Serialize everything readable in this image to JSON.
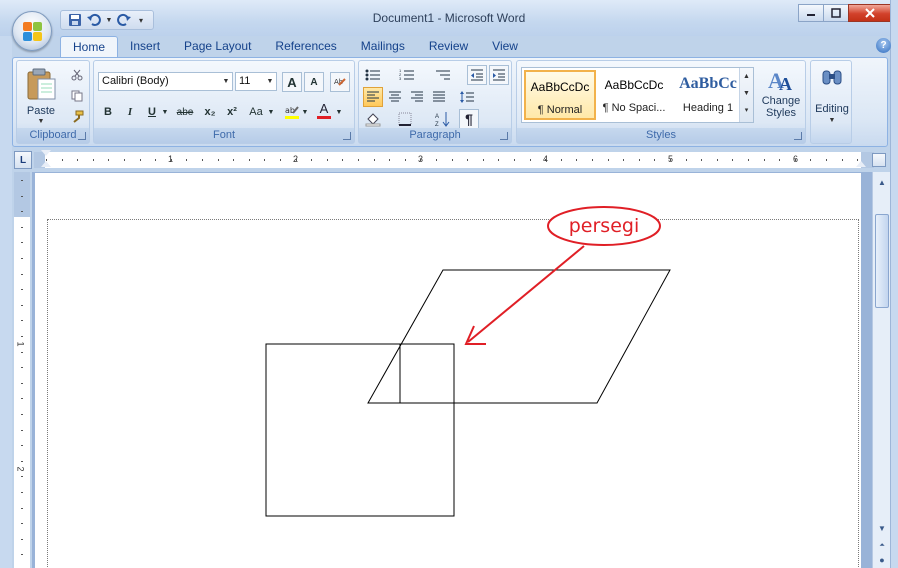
{
  "window": {
    "title": "Document1 - Microsoft Word"
  },
  "quick_access": {
    "icons": [
      "save-icon",
      "undo-icon",
      "redo-icon",
      "customize-icon"
    ]
  },
  "tabs": [
    {
      "label": "Home",
      "active": true
    },
    {
      "label": "Insert"
    },
    {
      "label": "Page Layout"
    },
    {
      "label": "References"
    },
    {
      "label": "Mailings"
    },
    {
      "label": "Review"
    },
    {
      "label": "View"
    }
  ],
  "ribbon": {
    "clipboard": {
      "paste_label": "Paste",
      "group_label": "Clipboard"
    },
    "font": {
      "font_name": "Calibri (Body)",
      "font_size": "11",
      "grow_label": "A",
      "shrink_label": "A",
      "bold_label": "B",
      "italic_label": "I",
      "underline_label": "U",
      "strike_label": "abe",
      "subscript_label": "x₂",
      "superscript_label": "x²",
      "case_label": "Aa",
      "font_color_label": "A",
      "group_label": "Font"
    },
    "paragraph": {
      "pilcrow_label": "¶",
      "group_label": "Paragraph"
    },
    "styles": {
      "items": [
        {
          "sample": "AaBbCcDc",
          "name": "¶ Normal"
        },
        {
          "sample": "AaBbCcDc",
          "name": "¶ No Spaci..."
        },
        {
          "sample": "AaBbCc",
          "name": "Heading 1"
        }
      ],
      "change_styles_line1": "Change",
      "change_styles_line2": "Styles",
      "group_label": "Styles"
    },
    "editing": {
      "label": "Editing"
    }
  },
  "ruler": {
    "corner_label": "L",
    "numbers": [
      "1",
      "2",
      "3",
      "4",
      "5",
      "6"
    ],
    "vertical_numbers": [
      "1",
      "2"
    ]
  },
  "annotation": {
    "label": "persegi"
  },
  "colors": {
    "accent": "#15428b",
    "annotation": "#e01f26",
    "ribbon": "#dbe7f5"
  }
}
